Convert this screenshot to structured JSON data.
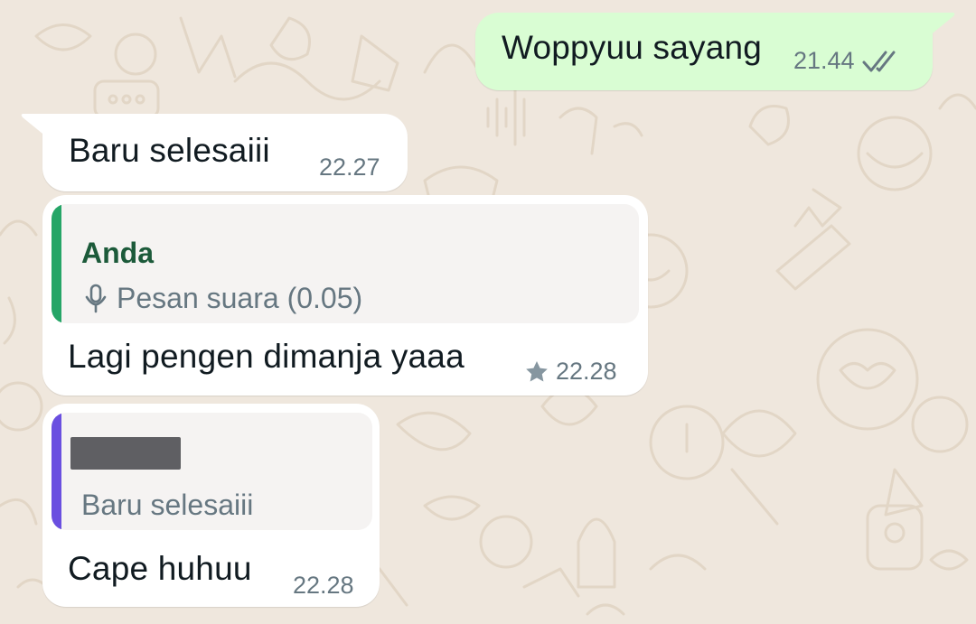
{
  "colors": {
    "wallpaper": "#efe7dd",
    "outgoing_bubble": "#d9fdd3",
    "incoming_bubble": "#ffffff",
    "quote_bar_self": "#25a567",
    "quote_bar_other": "#6a4fe0",
    "quote_name_self": "#1c5a3a",
    "meta_text": "#667781"
  },
  "messages": [
    {
      "direction": "outgoing",
      "text": "Woppyuu sayang",
      "time": "21.44",
      "status_icon": "double-check-icon"
    },
    {
      "direction": "incoming",
      "text": "Baru selesaiii",
      "time": "22.27"
    },
    {
      "direction": "incoming",
      "quote": {
        "author": "Anda",
        "icon": "microphone-icon",
        "text": "Pesan suara (0.05)"
      },
      "text": "Lagi pengen dimanja yaaa",
      "time": "22.28",
      "starred": true,
      "star_icon": "star-icon"
    },
    {
      "direction": "incoming",
      "quote": {
        "author_redacted": true,
        "text": "Baru selesaiii"
      },
      "text": "Cape huhuu",
      "time": "22.28"
    }
  ]
}
